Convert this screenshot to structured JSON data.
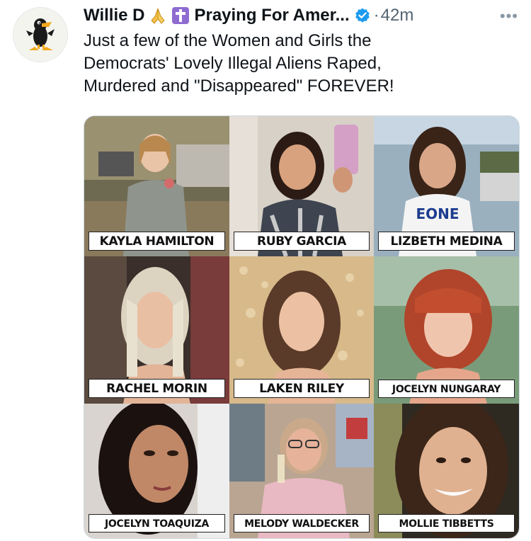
{
  "post": {
    "author_name": "Willie D",
    "secondary_name": "Praying For Amer...",
    "time_separator": "·",
    "timestamp": "42m",
    "more_label": "•••",
    "body_lines": [
      "Just a few of the Women and Girls the",
      "Democrats' Lovely Illegal Aliens Raped,",
      "Murdered and \"Disappeared\" FOREVER!"
    ],
    "icons": [
      "duck-avatar-icon",
      "praying-hands-icon",
      "cross-icon",
      "verified-badge-icon",
      "more-options-icon"
    ],
    "verified_color": "#1d9bf0"
  },
  "image_grid": {
    "labels": [
      "KAYLA HAMILTON",
      "RUBY GARCIA",
      "LIZBETH MEDINA",
      "RACHEL MORIN",
      "LAKEN RILEY",
      "JOCELYN NUNGARAY",
      "JOCELYN TOAQUIZA",
      "MELODY WALDECKER",
      "MOLLIE TIBBETTS"
    ]
  }
}
